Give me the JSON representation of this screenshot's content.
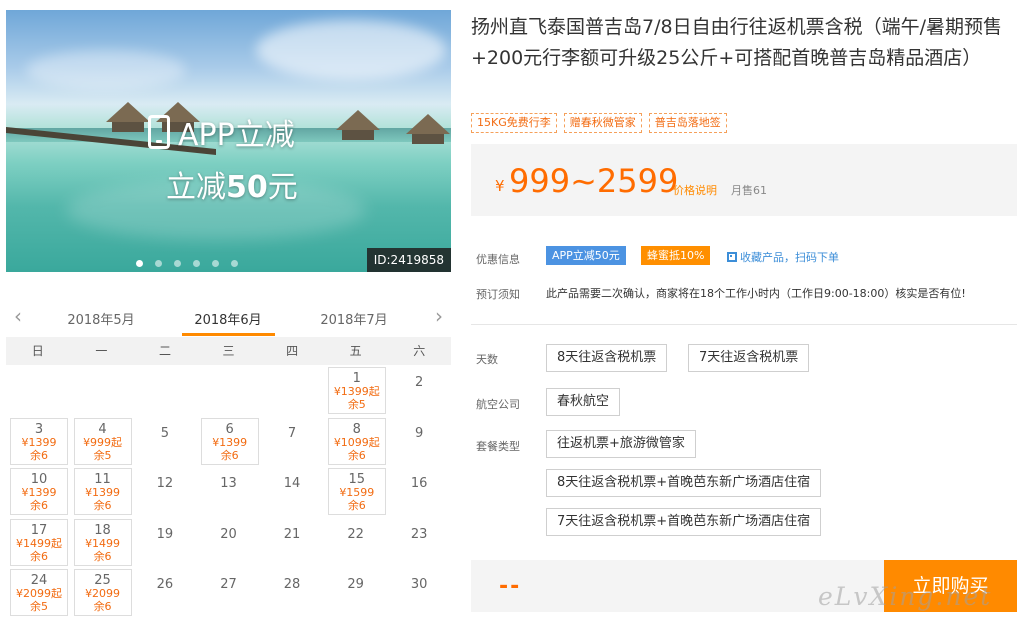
{
  "hero": {
    "promo_line1": "APP立减",
    "promo_line2_prefix": "立减",
    "promo_line2_amount": "50",
    "promo_line2_suffix": "元",
    "id_badge": "ID:2419858"
  },
  "calendar": {
    "months": [
      "2018年5月",
      "2018年6月",
      "2018年7月"
    ],
    "active_month_index": 1,
    "weekdays": [
      "日",
      "一",
      "二",
      "三",
      "四",
      "五",
      "六"
    ],
    "weeks": [
      [
        null,
        null,
        null,
        null,
        null,
        {
          "day": "1",
          "price": "¥1399起",
          "left": "余5"
        },
        {
          "day": "2"
        }
      ],
      [
        {
          "day": "3",
          "price": "¥1399",
          "left": "余6"
        },
        {
          "day": "4",
          "price": "¥999起",
          "left": "余5"
        },
        {
          "day": "5"
        },
        {
          "day": "6",
          "price": "¥1399",
          "left": "余6"
        },
        {
          "day": "7"
        },
        {
          "day": "8",
          "price": "¥1099起",
          "left": "余6"
        },
        {
          "day": "9"
        }
      ],
      [
        {
          "day": "10",
          "price": "¥1399",
          "left": "余6"
        },
        {
          "day": "11",
          "price": "¥1399",
          "left": "余6"
        },
        {
          "day": "12"
        },
        {
          "day": "13"
        },
        {
          "day": "14"
        },
        {
          "day": "15",
          "price": "¥1599",
          "left": "余6"
        },
        {
          "day": "16"
        }
      ],
      [
        {
          "day": "17",
          "price": "¥1499起",
          "left": "余6"
        },
        {
          "day": "18",
          "price": "¥1499",
          "left": "余6"
        },
        {
          "day": "19"
        },
        {
          "day": "20"
        },
        {
          "day": "21"
        },
        {
          "day": "22"
        },
        {
          "day": "23"
        }
      ],
      [
        {
          "day": "24",
          "price": "¥2099起",
          "left": "余5"
        },
        {
          "day": "25",
          "price": "¥2099",
          "left": "余6"
        },
        {
          "day": "26"
        },
        {
          "day": "27"
        },
        {
          "day": "28"
        },
        {
          "day": "29"
        },
        {
          "day": "30"
        }
      ]
    ]
  },
  "product": {
    "title": "扬州直飞泰国普吉岛7/8日自由行往返机票含税（端午/暑期预售+200元行李额可升级25公斤+可搭配首晚普吉岛精品酒店）",
    "tags": [
      "15KG免费行李",
      "赠春秋微管家",
      "普吉岛落地签"
    ],
    "price_currency": "¥",
    "price_range": "999~2599",
    "price_explain": "价格说明",
    "monthly_sales": "月售61"
  },
  "info": {
    "promo_label": "优惠信息",
    "badge_app": "APP立减50元",
    "badge_bee": "蜂蜜抵10%",
    "collect_text": "收藏产品，扫码下单",
    "notice_label": "预订须知",
    "notice_text": "此产品需要二次确认，商家将在18个工作小时内（工作日9:00-18:00）核实是否有位!"
  },
  "options": {
    "days_label": "天数",
    "days": [
      "8天往返含税机票",
      "7天往返含税机票"
    ],
    "airline_label": "航空公司",
    "airlines": [
      "春秋航空"
    ],
    "package_label": "套餐类型",
    "packages": [
      "往返机票+旅游微管家",
      "8天往返含税机票+首晚芭东新广场酒店住宿",
      "7天往返含税机票+首晚芭东新广场酒店住宿"
    ]
  },
  "footer": {
    "total_placeholder": "--",
    "buy_label": "立即购买",
    "watermark": "eLvXing.net"
  },
  "colors": {
    "accent_orange": "#ff8a00",
    "price_orange": "#ff6c00",
    "badge_blue": "#4c93e2"
  }
}
